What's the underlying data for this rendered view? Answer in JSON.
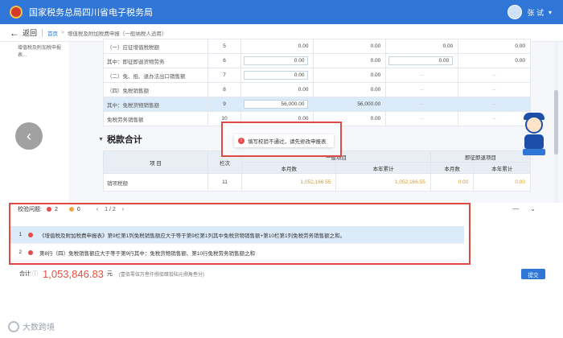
{
  "header": {
    "site_title": "国家税务总局四川省电子税务局",
    "user_name": "张 试",
    "user_caret": "▾"
  },
  "nav": {
    "back_label": "返回",
    "back_icon": "left-arrow",
    "breadcrumb_home": "首页",
    "breadcrumb_sep": ">",
    "breadcrumb_current": "增值税及附加税费申报（一般纳税人适用）"
  },
  "left_note": "增值税及附加税申报表...",
  "upper_rows": [
    {
      "label": "（一）应征增值税税额",
      "line": "5",
      "v1": "0.00",
      "v2": "0.00",
      "v3": "0.00",
      "v4": "0.00",
      "v1_boxed": false,
      "v3_boxed": false,
      "highlight": false
    },
    {
      "label": "其中：即征即退货物劳务",
      "line": "6",
      "v1": "0.00",
      "v2": "0.00",
      "v3": "0.00",
      "v4": "0.00",
      "v1_boxed": true,
      "v3_boxed": true,
      "highlight": false
    },
    {
      "label": "（二）免、抵、退办法出口销售额",
      "line": "7",
      "v1": "0.00",
      "v2": "0.00",
      "v3": "--",
      "v4": "--",
      "v1_boxed": true,
      "v3_boxed": false,
      "highlight": false
    },
    {
      "label": "（四）免税销售额",
      "line": "8",
      "v1": "0.00",
      "v2": "0.00",
      "v3": "--",
      "v4": "--",
      "v1_boxed": false,
      "v3_boxed": false,
      "highlight": false
    },
    {
      "label": "其中：免税货物销售额",
      "line": "9",
      "v1": "56,000.00",
      "v2": "56,000.00",
      "v3": "--",
      "v4": "--",
      "v1_boxed": true,
      "v3_boxed": false,
      "highlight": true
    },
    {
      "label": "免税劳务销售额",
      "line": "10",
      "v1": "0.00",
      "v2": "0.00",
      "v3": "--",
      "v4": "--",
      "v1_boxed": false,
      "v3_boxed": false,
      "highlight": false
    }
  ],
  "tax_section": {
    "title": "税款合计",
    "caret": "▼",
    "col_item": "项 目",
    "col_line": "栏次",
    "group_general": "一般项目",
    "group_refund": "即征即退项目",
    "sub_month": "本月数",
    "sub_ytd": "本年累计",
    "row": {
      "label": "销项税额",
      "line": "11",
      "month": "1,052,166.55",
      "ytd": "1,052,166.55",
      "refund_month": "0.00",
      "refund_ytd": "0.00"
    }
  },
  "toast": {
    "icon": "error-circle-icon",
    "text": "填写校验不通过，请先修改申报表"
  },
  "check_bar": {
    "title": "校验问题:",
    "error_count": "2",
    "warning_count": "0",
    "pager_prev": "‹",
    "pager_text": "1 / 2",
    "pager_next": "›",
    "minimize": "—",
    "expand": "⌄"
  },
  "errors": [
    {
      "index": "1",
      "text": "《增值税及附加税费申报表》第9栏第1列免税销售额应大于等于第9栏第1列其中免税货物销售额+第10栏第1列免税劳务销售额之和。"
    },
    {
      "index": "2",
      "text": "第8行（四）免税销售额应大于等于第9行其中：免税货物销售额、第10行免税劳务销售额之和"
    }
  ],
  "total": {
    "label": "合计",
    "amount": "1,053,846.83",
    "unit": "元",
    "chinese": "(壹佰零伍万叁仟捌佰肆拾陆元捌角叁分)",
    "submit": "提交"
  },
  "watermark": "大数跨境",
  "colors": {
    "brand": "#2f76d7",
    "error": "#e84b4b",
    "amount": "#e8513e",
    "warning": "#f0a640"
  }
}
